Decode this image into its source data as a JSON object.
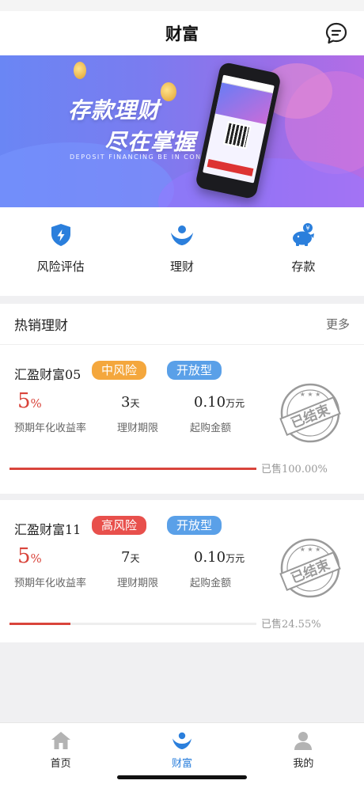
{
  "header": {
    "title": "财富"
  },
  "banner": {
    "headline_1": "存款理财",
    "headline_2": "尽在掌握",
    "subtitle": "DEPOSIT FINANCING BE IN CONTROL"
  },
  "quick_actions": [
    {
      "label": "风险评估",
      "icon": "shield-bolt-icon"
    },
    {
      "label": "理财",
      "icon": "wealth-icon"
    },
    {
      "label": "存款",
      "icon": "piggy-bank-icon"
    }
  ],
  "hot_section": {
    "title": "热销理财",
    "more": "更多"
  },
  "products": [
    {
      "name": "汇盈财富05",
      "risk": "中风险",
      "type": "开放型",
      "rate": "5",
      "rate_unit": "%",
      "rate_label": "预期年化收益率",
      "term": "3",
      "term_unit": "天",
      "term_label": "理财期限",
      "min_amount": "0.10",
      "min_unit": "万元",
      "min_label": "起购金额",
      "sold_text": "已售100.00%",
      "sold_fraction": 1.0,
      "stamp": "已结束"
    },
    {
      "name": "汇盈财富11",
      "risk": "高风险",
      "type": "开放型",
      "rate": "5",
      "rate_unit": "%",
      "rate_label": "预期年化收益率",
      "term": "7",
      "term_unit": "天",
      "term_label": "理财期限",
      "min_amount": "0.10",
      "min_unit": "万元",
      "min_label": "起购金额",
      "sold_text": "已售24.55%",
      "sold_fraction": 0.2455,
      "stamp": "已结束"
    }
  ],
  "tabbar": [
    {
      "label": "首页",
      "icon": "home-icon"
    },
    {
      "label": "财富",
      "icon": "wealth-icon",
      "active": true
    },
    {
      "label": "我的",
      "icon": "person-icon"
    }
  ],
  "colors": {
    "accent_blue": "#2b7fdc",
    "risk_mid": "#f4a73d",
    "risk_high": "#e8504c",
    "open_type": "#5aa0e8",
    "rate_red": "#d9443b"
  }
}
